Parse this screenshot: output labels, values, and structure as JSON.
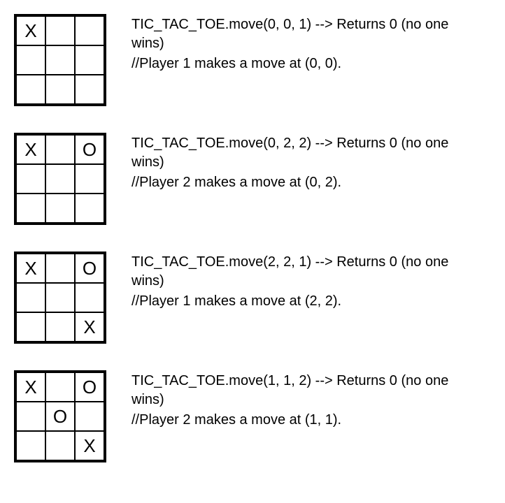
{
  "steps": [
    {
      "board": [
        [
          "X",
          "",
          ""
        ],
        [
          "",
          "",
          ""
        ],
        [
          "",
          "",
          ""
        ]
      ],
      "call": "TIC_TAC_TOE.move(0, 0, 1) --> Returns 0 (no one wins)",
      "comment": "//Player 1 makes a move at (0, 0)."
    },
    {
      "board": [
        [
          "X",
          "",
          "O"
        ],
        [
          "",
          "",
          ""
        ],
        [
          "",
          "",
          ""
        ]
      ],
      "call": "TIC_TAC_TOE.move(0, 2, 2) --> Returns 0 (no one wins)",
      "comment": "//Player 2 makes a move at (0, 2)."
    },
    {
      "board": [
        [
          "X",
          "",
          "O"
        ],
        [
          "",
          "",
          ""
        ],
        [
          "",
          "",
          "X"
        ]
      ],
      "call": "TIC_TAC_TOE.move(2, 2, 1) --> Returns 0 (no one wins)",
      "comment": "//Player 1 makes a move at (2, 2)."
    },
    {
      "board": [
        [
          "X",
          "",
          "O"
        ],
        [
          "",
          "O",
          ""
        ],
        [
          "",
          "",
          "X"
        ]
      ],
      "call": "TIC_TAC_TOE.move(1, 1, 2) --> Returns 0 (no one wins)",
      "comment": "//Player 2 makes a move at (1, 1)."
    }
  ]
}
